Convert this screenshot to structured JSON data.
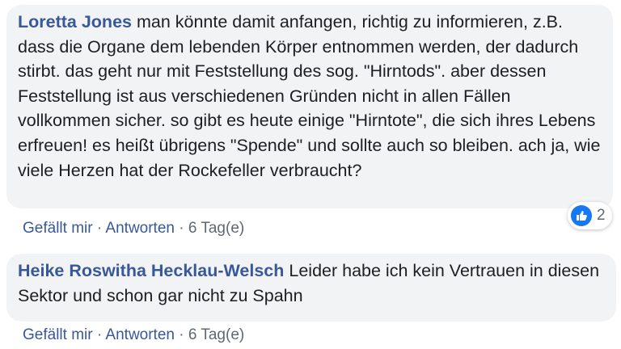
{
  "comments": [
    {
      "author": "Loretta Jones",
      "text": "man könnte damit anfangen, richtig zu informieren, z.B. dass die Organe dem lebenden Körper entnommen werden, der dadurch stirbt. das geht nur mit Feststellung des sog. \"Hirntods\". aber dessen Feststellung ist aus verschiedenen Gründen nicht in allen Fällen vollkommen sicher. so gibt es heute einige \"Hirntote\", die sich ihres Lebens erfreuen! es heißt übrigens \"Spende\" und sollte auch so bleiben. ach ja, wie viele Herzen hat der Rockefeller verbraucht?",
      "like_label": "Gefällt mir",
      "reply_label": "Antworten",
      "time": "6 Tag(e)",
      "reaction_count": "2",
      "reaction_icon": "thumbs-up-icon"
    },
    {
      "author": "Heike Roswitha Hecklau-Welsch",
      "text": "Leider habe ich kein Vertrauen in diesen Sektor und schon gar nicht zu Spahn",
      "like_label": "Gefällt mir",
      "reply_label": "Antworten",
      "time": "6 Tag(e)"
    }
  ],
  "separator": "·",
  "colors": {
    "author": "#385898",
    "bubble_bg": "#f2f3f5",
    "text": "#1c1e21",
    "meta": "#606770",
    "like_blue": "#1877f2"
  }
}
